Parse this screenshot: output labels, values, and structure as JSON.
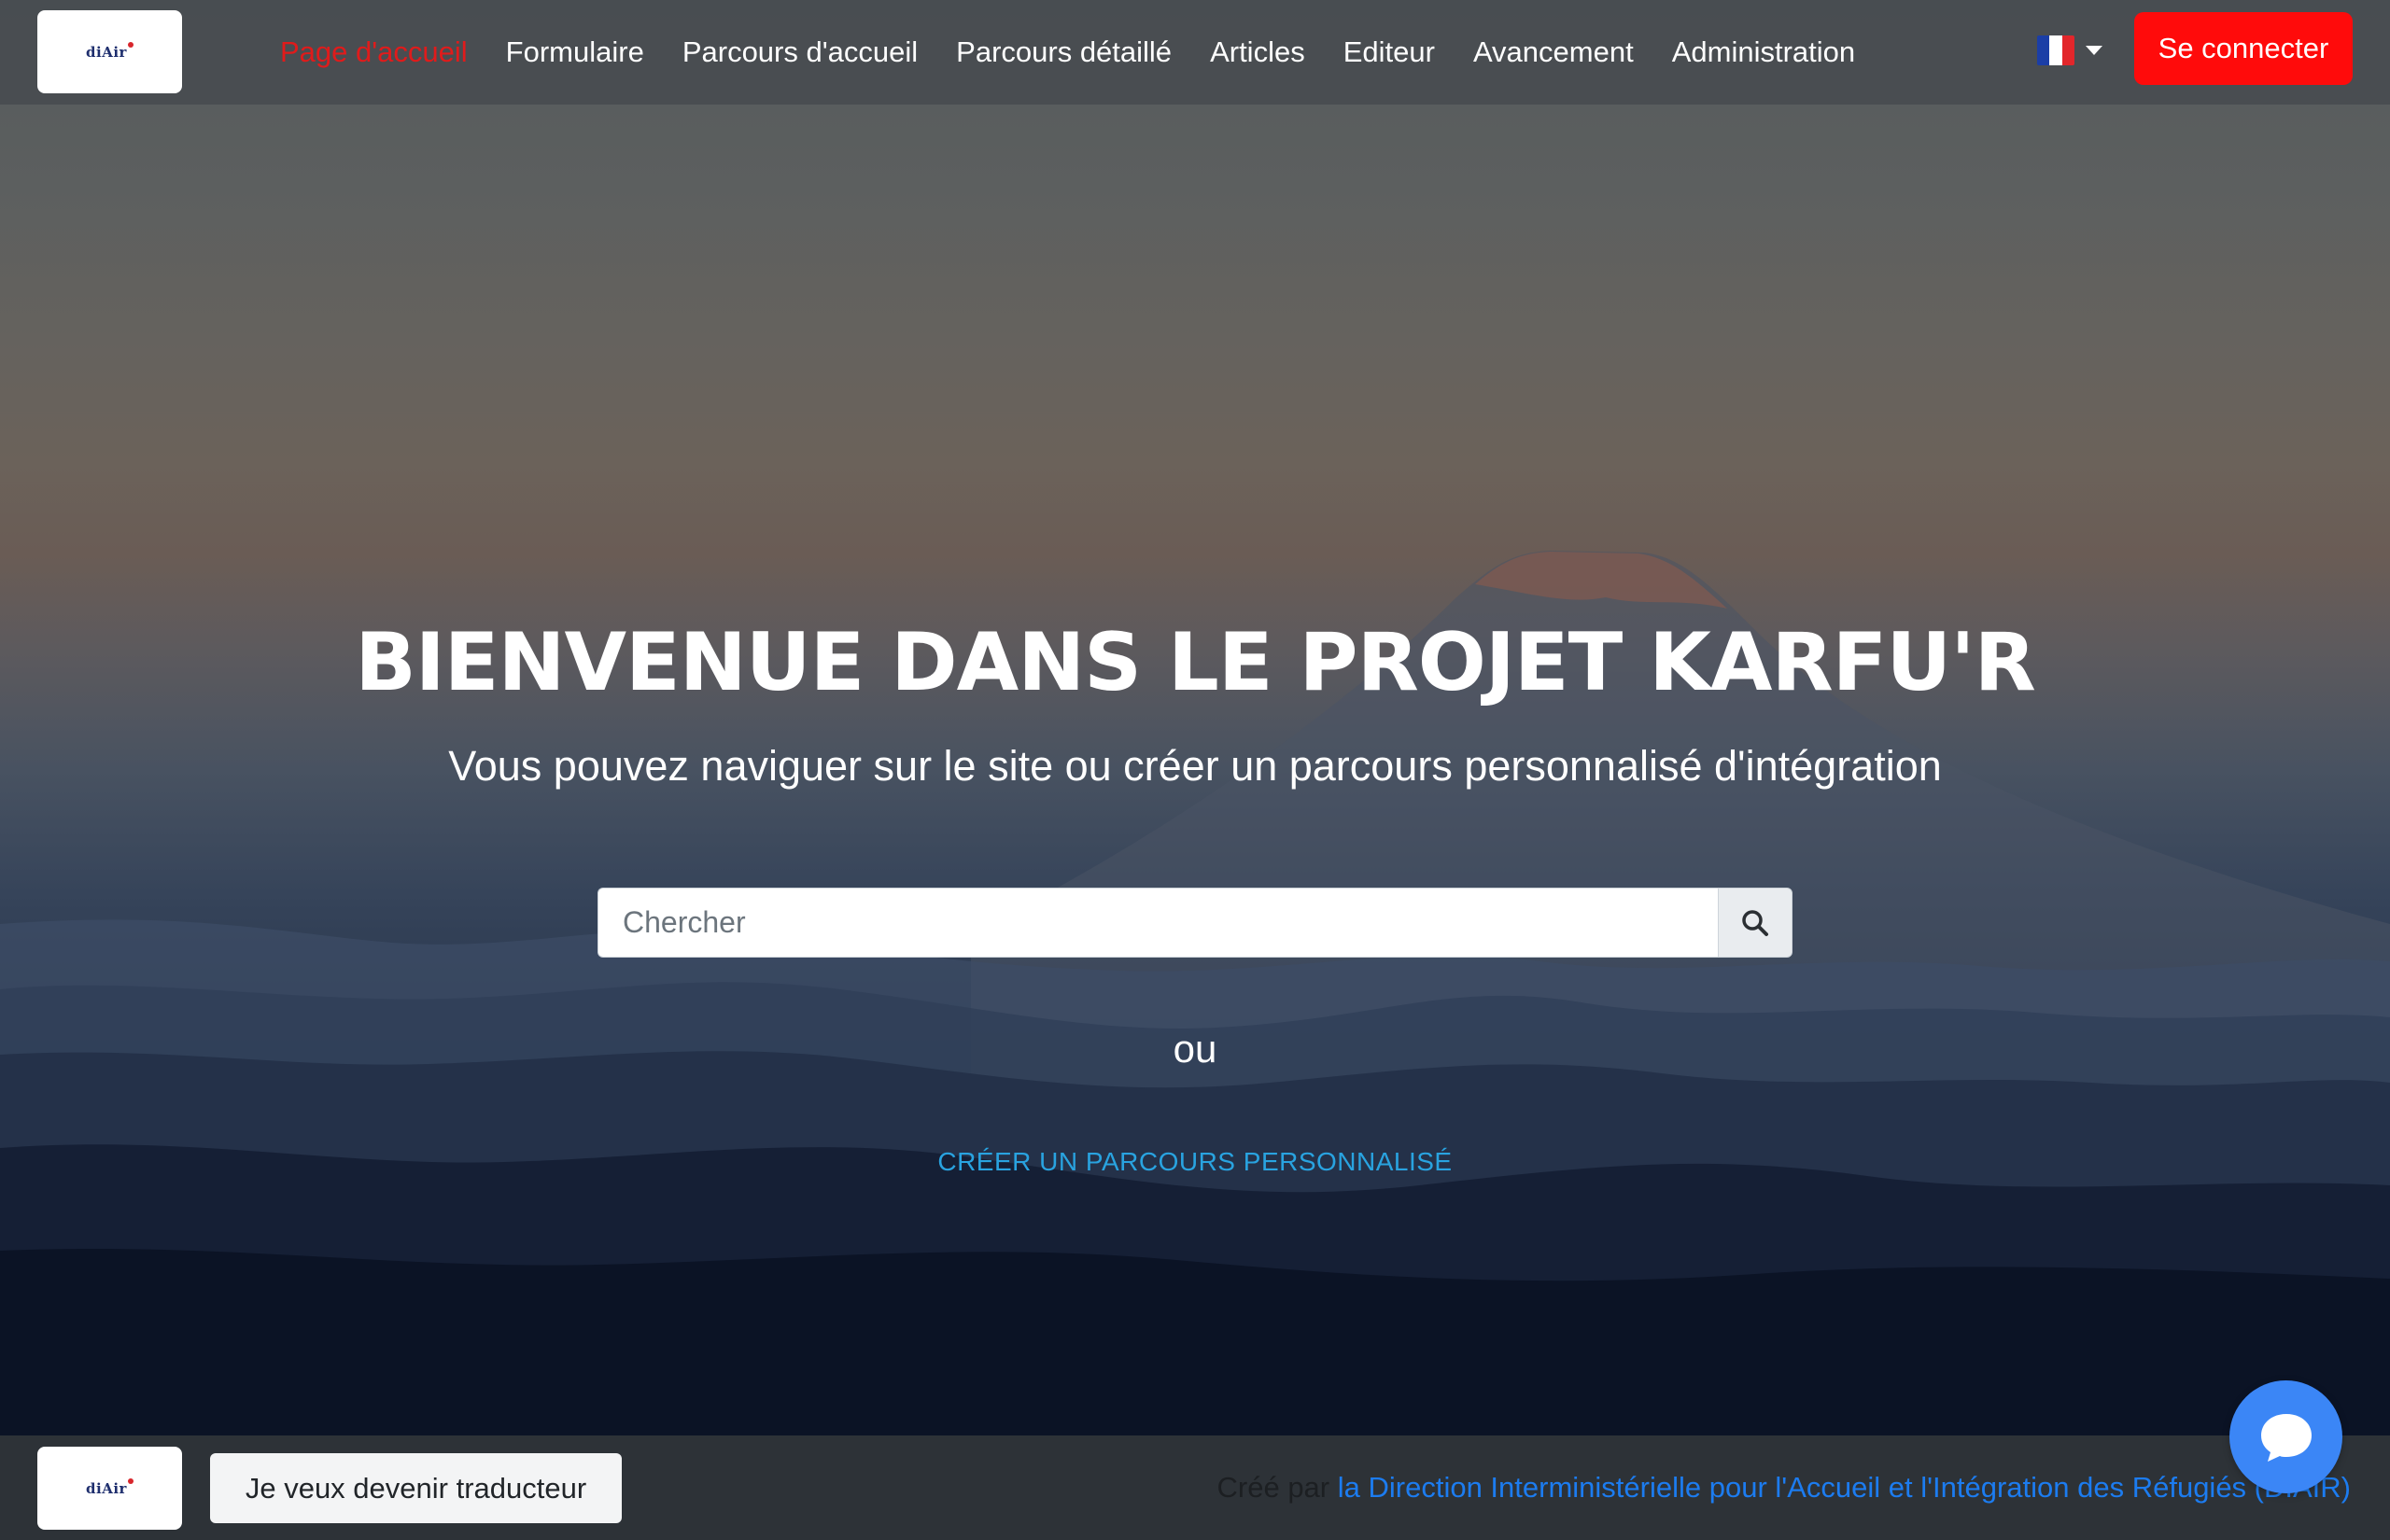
{
  "header": {
    "logo_text": "diAir",
    "nav_items": [
      {
        "label": "Page d'accueil",
        "active": true
      },
      {
        "label": "Formulaire"
      },
      {
        "label": "Parcours d'accueil"
      },
      {
        "label": "Parcours détaillé"
      },
      {
        "label": "Articles"
      },
      {
        "label": "Editeur"
      },
      {
        "label": "Avancement"
      },
      {
        "label": "Administration"
      }
    ],
    "language_flag": "fr-flag-icon",
    "login_label": "Se connecter"
  },
  "hero": {
    "title": "BIENVENUE DANS LE PROJET KARFU'R",
    "subtitle": "Vous pouvez naviguer sur le site ou créer un parcours personnalisé d'intégration",
    "search": {
      "placeholder": "Chercher",
      "value": "",
      "button_icon": "search-icon"
    },
    "or_text": "ou",
    "create_link": "CRÉER UN PARCOURS PERSONNALISÉ"
  },
  "footer": {
    "logo_text": "diAir",
    "translator_button": "Je veux devenir traducteur",
    "credit_prefix": "Créé par",
    "credit_link": "la Direction Interministérielle pour l'Accueil et l'Intégration des Réfugiés (DIAIR)"
  },
  "chat_widget": {
    "icon": "chat-bubble-icon"
  },
  "colors": {
    "nav_active": "#e01b1b",
    "login_button": "#ff0b0b",
    "create_link": "#29a3e0",
    "credit_link": "#1c7cf0",
    "chat_widget": "#3b86f6"
  }
}
